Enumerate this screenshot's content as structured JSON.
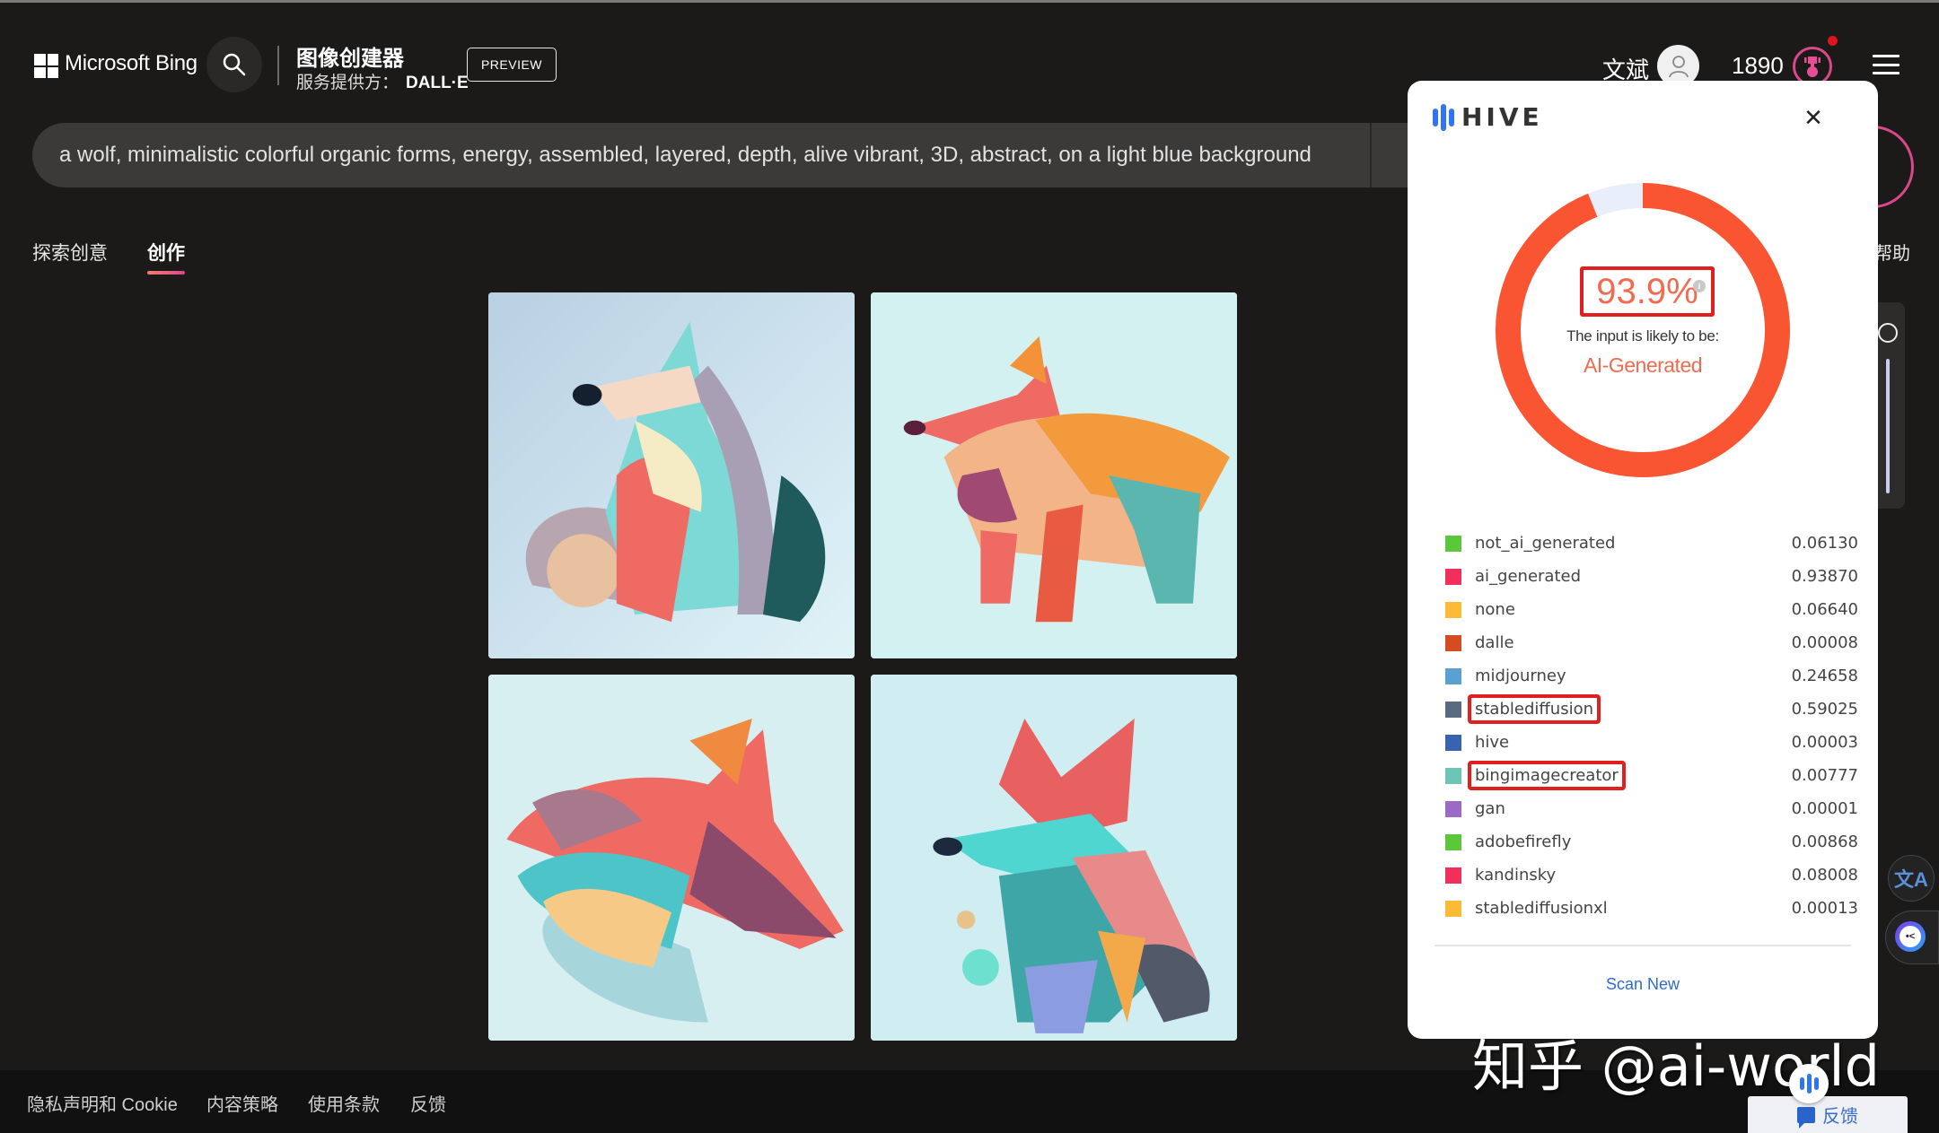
{
  "header": {
    "brand": "Microsoft Bing",
    "app_title": "图像创建器",
    "provider_label": "服务提供方：",
    "provider_name": "DALL·E",
    "preview_label": "PREVIEW",
    "user_name": "文斌",
    "points": "1890"
  },
  "prompt": {
    "value": "a wolf, minimalistic colorful organic forms, energy, assembled, layered, depth, alive vibrant, 3D, abstract, on a light blue background"
  },
  "tabs": [
    {
      "label": "探索创意",
      "active": false
    },
    {
      "label": "创作",
      "active": true
    }
  ],
  "help_label": "帮助",
  "images": [
    {
      "alt": "wolf image 1"
    },
    {
      "alt": "wolf image 2"
    },
    {
      "alt": "wolf image 3"
    },
    {
      "alt": "wolf image 4"
    }
  ],
  "hive": {
    "logo_text": "HIVE",
    "score": "93.9%",
    "score_fraction": 0.939,
    "likely_label": "The input is likely to be:",
    "verdict": "AI-Generated",
    "accent_color": "#fa5533",
    "classes": [
      {
        "name": "not_ai_generated",
        "value": "0.06130",
        "color": "#5ac83a"
      },
      {
        "name": "ai_generated",
        "value": "0.93870",
        "color": "#f0305a"
      },
      {
        "name": "none",
        "value": "0.06640",
        "color": "#fbbb36"
      },
      {
        "name": "dalle",
        "value": "0.00008",
        "color": "#d54b22"
      },
      {
        "name": "midjourney",
        "value": "0.24658",
        "color": "#5aa0d0"
      },
      {
        "name": "stablediffusion",
        "value": "0.59025",
        "color": "#5a6a80",
        "highlighted": true
      },
      {
        "name": "hive",
        "value": "0.00003",
        "color": "#3863b0"
      },
      {
        "name": "bingimagecreator",
        "value": "0.00777",
        "color": "#6fc4b8",
        "highlighted": true
      },
      {
        "name": "gan",
        "value": "0.00001",
        "color": "#9a6ac6"
      },
      {
        "name": "adobefirefly",
        "value": "0.00868",
        "color": "#5ac83a"
      },
      {
        "name": "kandinsky",
        "value": "0.08008",
        "color": "#f0305a"
      },
      {
        "name": "stablediffusionxl",
        "value": "0.00013",
        "color": "#fbbb36"
      }
    ],
    "scan_new_label": "Scan New"
  },
  "footer": {
    "links": [
      "隐私声明和 Cookie",
      "内容策略",
      "使用条款",
      "反馈"
    ]
  },
  "feedback_button": "反馈",
  "watermark": "知乎 @ai-world"
}
